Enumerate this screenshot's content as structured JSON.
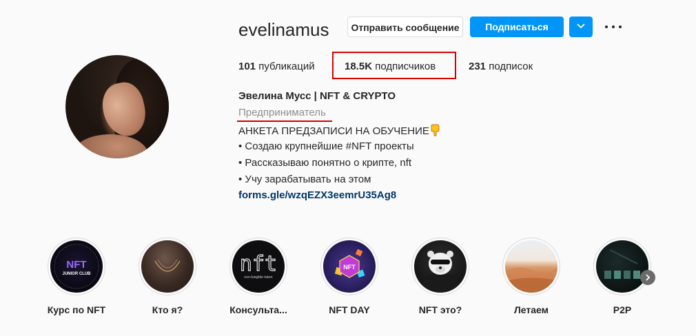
{
  "profile": {
    "username": "evelinamus",
    "message_button": "Отправить сообщение",
    "follow_button": "Подписаться"
  },
  "stats": {
    "posts_count": "101",
    "posts_label": "публикаций",
    "followers_count": "18.5K",
    "followers_label": "подписчиков",
    "following_count": "231",
    "following_label": "подписок"
  },
  "bio": {
    "full_name": "Эвелина Мусс | NFT & CRYPTO",
    "category": "Предприниматель",
    "lines": [
      "АНКЕТА ПРЕДЗАПИСИ НА ОБУЧЕНИЕ",
      "• Создаю крупнейшие #NFT проекты",
      "• Рассказываю понятно о крипте, nft",
      "• Учу зарабатывать на этом"
    ],
    "link": "forms.gle/wzqEZX3eemrU35Ag8"
  },
  "highlights": [
    {
      "label": "Курс по NFT",
      "cover_text": "NFT",
      "cover_sub": "JUNIOR CLUB"
    },
    {
      "label": "Кто я?"
    },
    {
      "label": "Консульта...",
      "cover_text": "nft",
      "cover_sub": "non-fungible token"
    },
    {
      "label": "NFT DAY",
      "cover_text": "NFT"
    },
    {
      "label": "NFT это?"
    },
    {
      "label": "Летаем"
    },
    {
      "label": "P2P"
    }
  ],
  "colors": {
    "accent": "#0095f6",
    "highlight_box": "#d90000",
    "link": "#00376b",
    "muted": "#8e8e8e"
  }
}
